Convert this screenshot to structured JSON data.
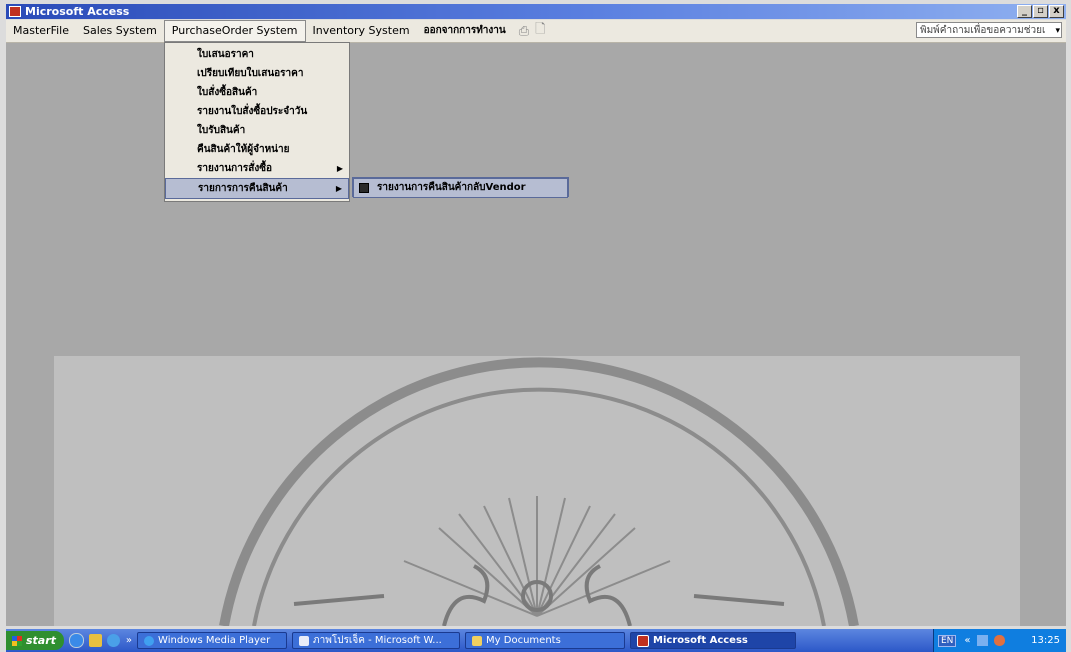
{
  "window": {
    "title": "Microsoft Access",
    "buttons": {
      "minimize": "_",
      "maximize": "▫",
      "close": "x"
    }
  },
  "menubar": {
    "items": [
      {
        "label": "MasterFile"
      },
      {
        "label": "Sales System"
      },
      {
        "label": "PurchaseOrder System",
        "open": true
      },
      {
        "label": "Inventory System"
      },
      {
        "label": "ออกจากการทำงาน"
      }
    ],
    "help_box": "พิมพ์คำถามเพื่อขอความช่วยเ"
  },
  "dropdown": {
    "items": [
      {
        "label": "ใบเสนอราคา"
      },
      {
        "label": "เปรียบเทียบใบเสนอราคา"
      },
      {
        "label": "ใบสั่งซื้อสินค้า"
      },
      {
        "label": "รายงานใบสั่งซื้อประจำวัน"
      },
      {
        "label": "ใบรับสินค้า"
      },
      {
        "label": "คืนสินค้าให้ผู้จำหน่าย"
      },
      {
        "label": "รายงานการสั่งซื้อ",
        "submenu": true
      },
      {
        "label": "รายการการคืนสินค้า",
        "submenu": true,
        "highlighted": true
      }
    ]
  },
  "submenu": {
    "items": [
      {
        "label": "รายงานการคืนสินค้ากลับVendor",
        "icon": "report-icon"
      }
    ]
  },
  "taskbar": {
    "start": "start",
    "quick_launch_chevron": "»",
    "tasks": [
      {
        "label": "Windows Media Player",
        "icon": "media-player-icon"
      },
      {
        "label": "ภาพโปรเจ็ค - Microsoft W...",
        "icon": "word-icon"
      },
      {
        "label": "My Documents",
        "icon": "folder-icon"
      },
      {
        "label": "Microsoft Access",
        "icon": "access-icon",
        "active": true
      }
    ],
    "tray": {
      "language": "EN",
      "chevron": "«",
      "clock": "13:25"
    }
  },
  "colors": {
    "title_bar": "#2a4bb8",
    "menu_bg": "#ece9e0",
    "highlight": "#b6bdd2",
    "workspace": "#a8a8a8",
    "taskbar": "#2c58c8"
  }
}
